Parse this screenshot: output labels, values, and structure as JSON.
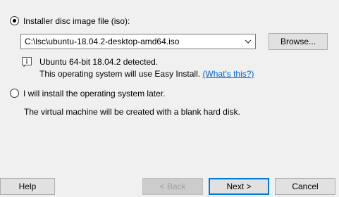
{
  "options": {
    "iso": {
      "label": "Installer disc image file (iso):",
      "selected": true
    },
    "later": {
      "label": "I will install the operating system later.",
      "selected": false
    }
  },
  "iso_path": {
    "value": "C:\\lsc\\ubuntu-18.04.2-desktop-amd64.iso"
  },
  "browse_label": "Browse...",
  "detection": {
    "line1": "Ubuntu 64-bit 18.04.2 detected.",
    "line2": "This operating system will use Easy Install.",
    "link": "(What's this?)"
  },
  "later_note": "The virtual machine will be created with a blank hard disk.",
  "buttons": {
    "help": "Help",
    "back": "< Back",
    "next": "Next >",
    "cancel": "Cancel"
  },
  "colors": {
    "accent": "#0078d7",
    "link": "#0066cc"
  }
}
